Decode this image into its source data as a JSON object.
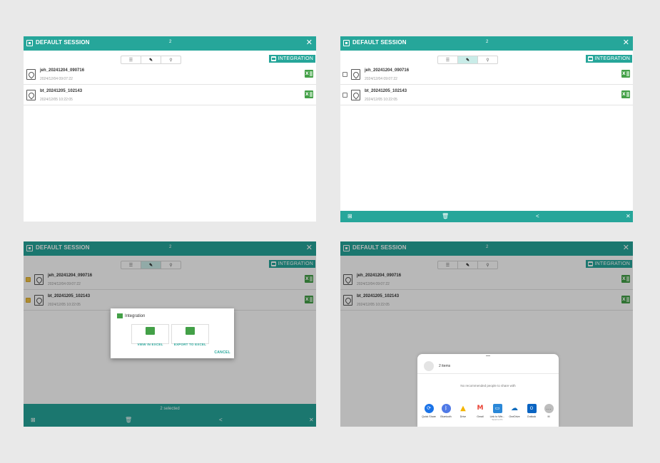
{
  "session_title": "DEFAULT SESSION",
  "count": "2",
  "integration_label": "INTEGRATION",
  "files": [
    {
      "name": "jeh_20241204_090716",
      "date": "2024/12/04 09:07:22"
    },
    {
      "name": "bt_20241205_102143",
      "date": "2024/12/05 10:22:05"
    }
  ],
  "selection_status": "2 selected",
  "integration_dialog": {
    "title": "Integration",
    "view_label": "VIEW IN EXCEL",
    "export_label": "EXPORT TO EXCEL",
    "cancel_label": "CANCEL"
  },
  "share_sheet": {
    "items_label": "2 items",
    "no_people": "No recommended people to share with",
    "apps": [
      {
        "label": "Quick Share",
        "icon": "quick-share-icon",
        "color": "#1a73e8"
      },
      {
        "label": "Bluetooth",
        "icon": "bluetooth-icon",
        "color": "#4f79e6"
      },
      {
        "label": "Drive",
        "icon": "drive-icon",
        "color": "#f4b400"
      },
      {
        "label": "Gmail",
        "icon": "gmail-icon",
        "color": "#ea4335"
      },
      {
        "label": "Link to Win...",
        "sublabel": "Send to PC",
        "icon": "link-to-windows-icon",
        "color": "#2b88d8"
      },
      {
        "label": "OneDrive",
        "icon": "onedrive-icon",
        "color": "#0f6cbd"
      },
      {
        "label": "Outlook",
        "icon": "outlook-icon",
        "color": "#0a64c2"
      },
      {
        "label": "M",
        "icon": "more-icon",
        "color": "#bdbdbd"
      }
    ]
  },
  "colors": {
    "teal": "#26a69a",
    "excel_green": "#43a047",
    "checkbox_checked": "#f0c343"
  }
}
